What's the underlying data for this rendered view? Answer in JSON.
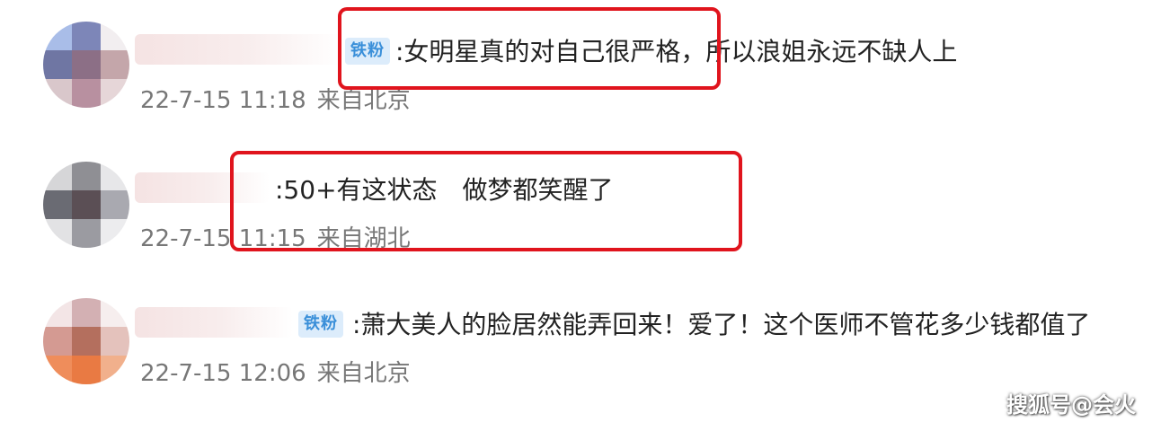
{
  "comments": [
    {
      "badge": "铁粉",
      "text": ":女明星真的对自己很严格，所以浪姐永远不缺人上",
      "time": "22-7-15 11:18",
      "location": "来自北京",
      "highlight_color": "#e0141d"
    },
    {
      "badge": "",
      "text": ":50+有这状态　做梦都笑醒了",
      "time": "22-7-15 11:15",
      "location": "来自湖北",
      "highlight_color": "#e0141d"
    },
    {
      "badge": "铁粉",
      "text": ":萧大美人的脸居然能弄回来！爱了！这个医师不管花多少钱都值了",
      "time": "22-7-15 12:06",
      "location": "来自北京",
      "highlight_color": ""
    }
  ],
  "watermark": "搜狐号@会火",
  "colors": {
    "badge_bg": "#dcecfb",
    "badge_text": "#3a8fd9",
    "highlight": "#e0141d",
    "meta_text": "#777777"
  }
}
